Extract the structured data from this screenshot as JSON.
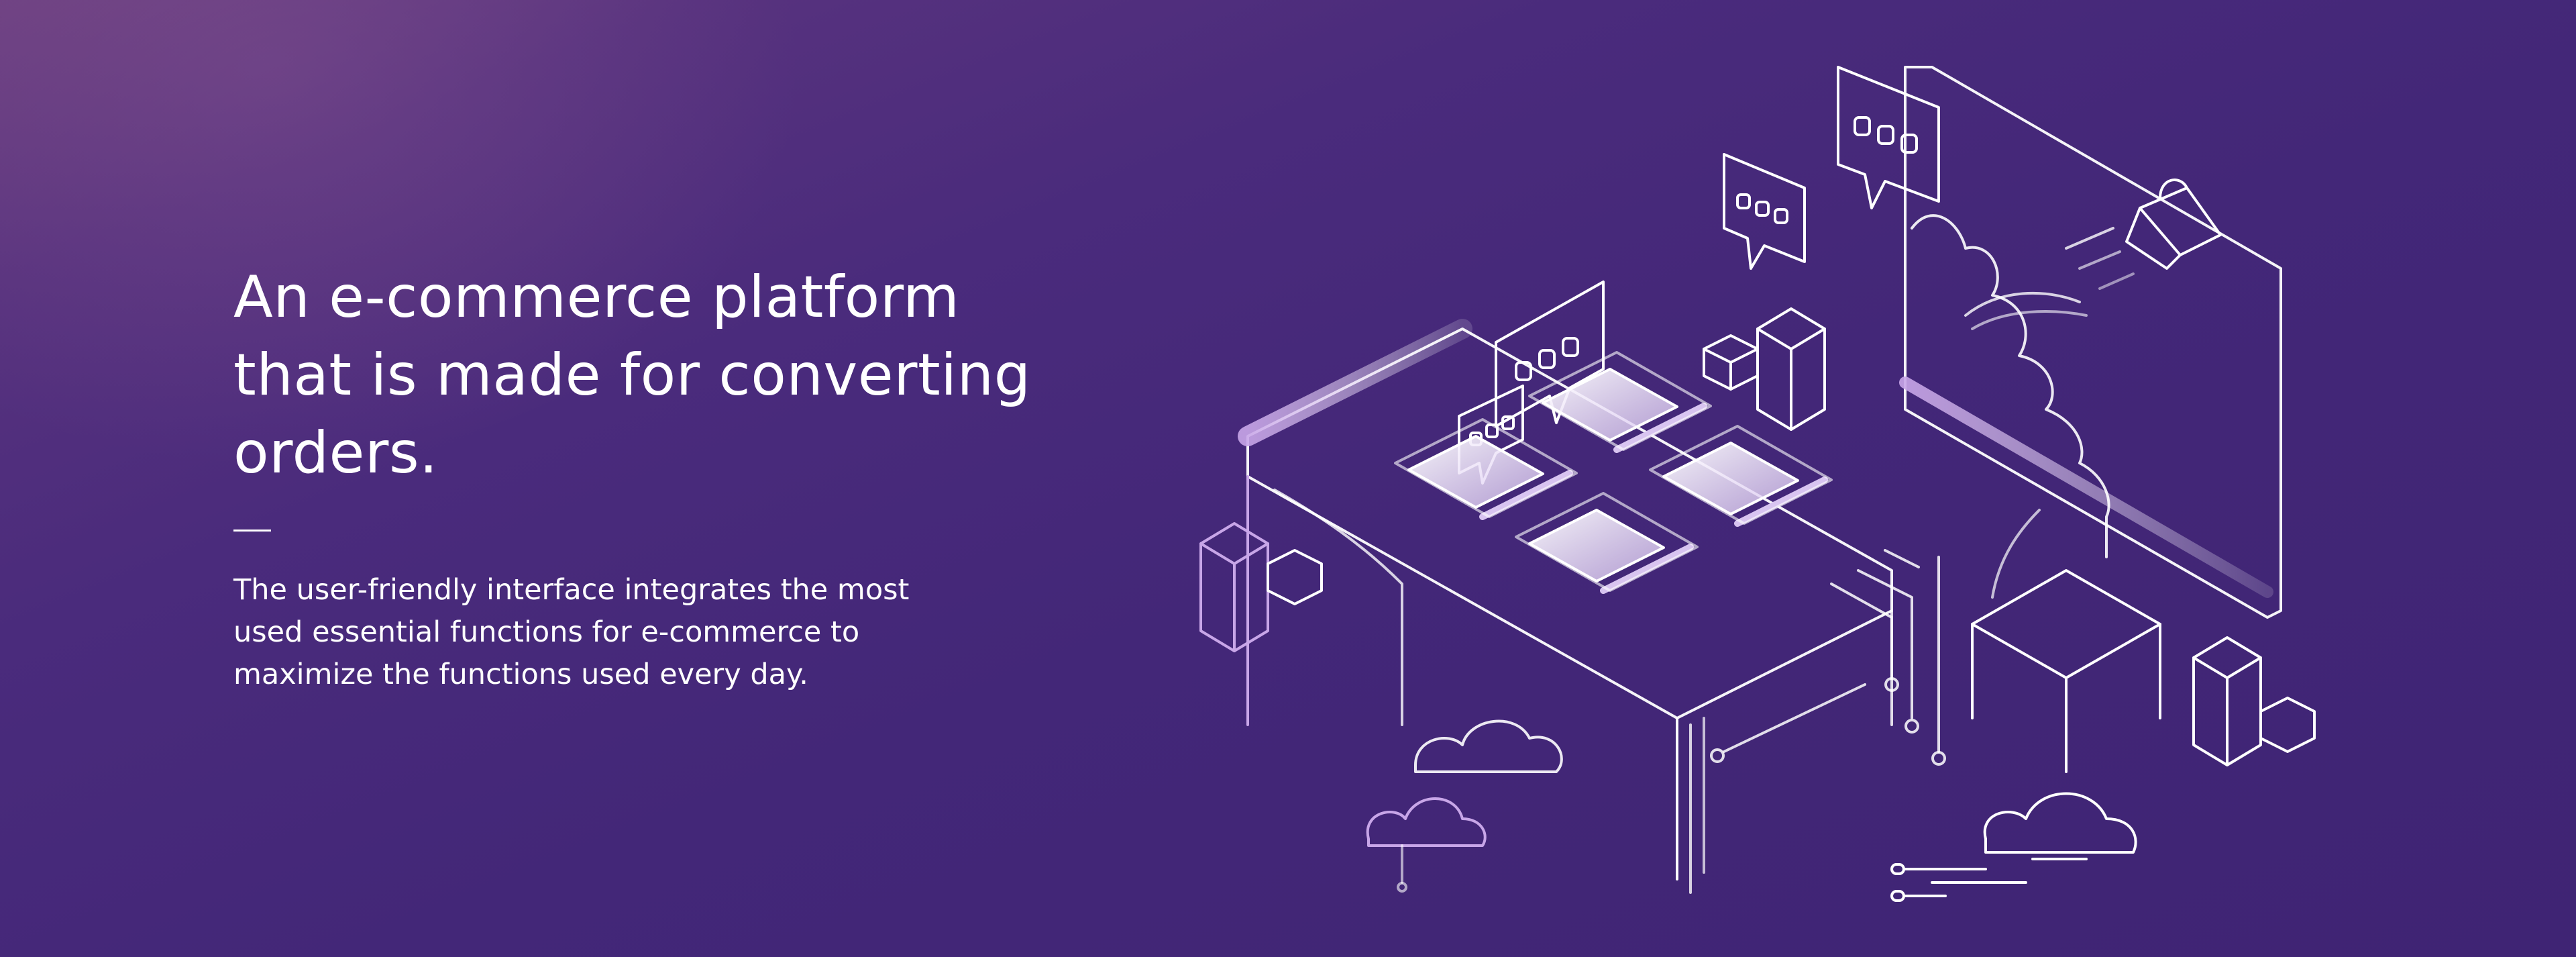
{
  "hero": {
    "headline": "An e-commerce platform\nthat is made for converting\norders.",
    "description": "The user-friendly interface integrates the most\nused essential functions for e-commerce to\nmaximize the functions used every day."
  },
  "colors": {
    "background_top_left": "#6b3f80",
    "background_main": "#432778",
    "line_art": "#ffffff",
    "accent_lilac": "#c8a6e8"
  },
  "illustration": {
    "icons": [
      "chat-bubble-icon",
      "shopping-bag-icon",
      "cloud-icon",
      "box-stack-icon",
      "product-card-icon"
    ]
  }
}
